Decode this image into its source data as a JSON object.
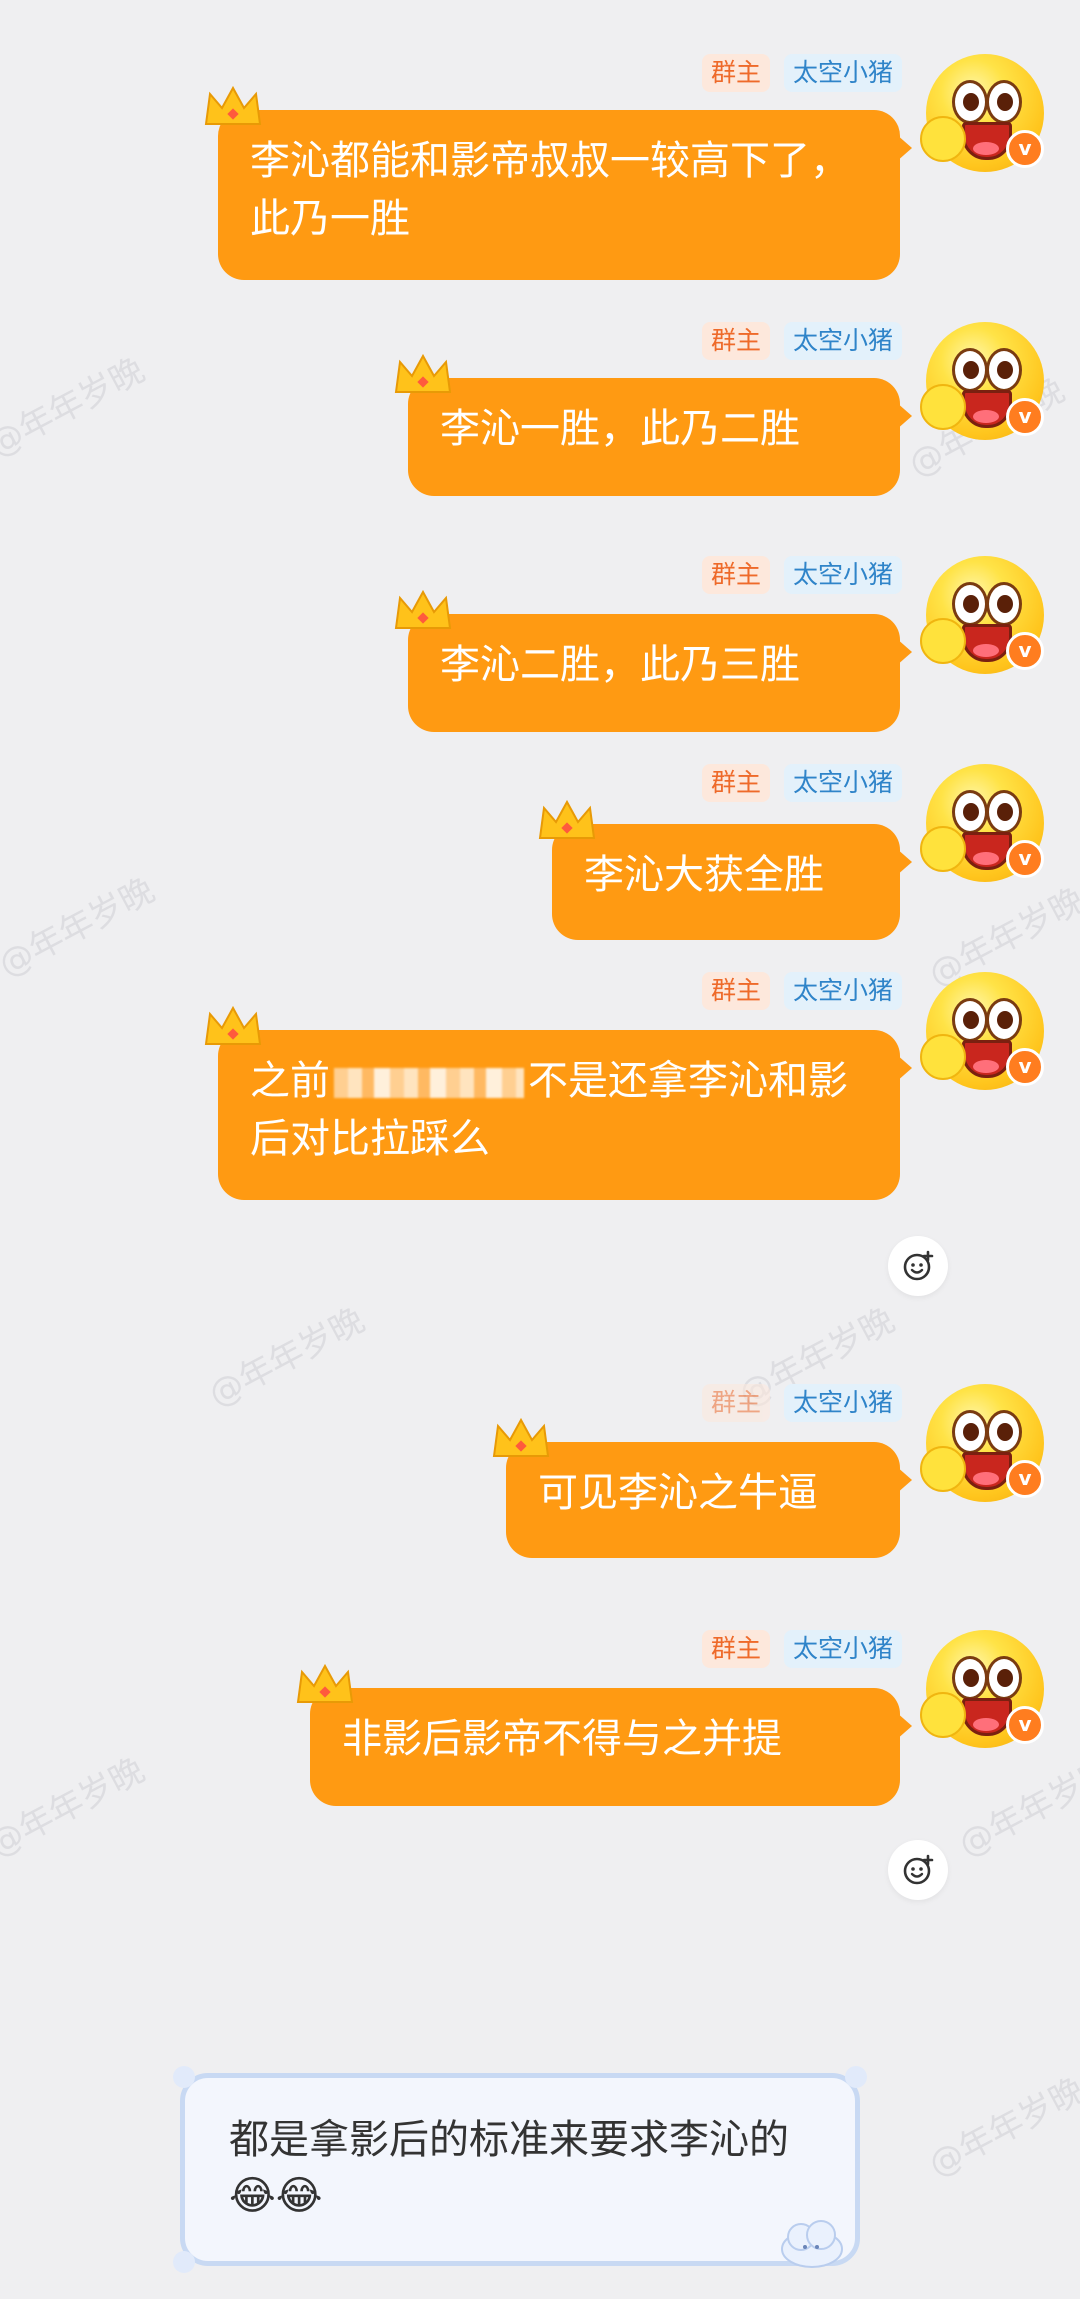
{
  "watermark": "@年年岁晚",
  "messages": [
    {
      "owner_tag": "群主",
      "name_tag": "太空小猪",
      "text": "李沁都能和影帝叔叔一较高下了，此乃一胜"
    },
    {
      "owner_tag": "群主",
      "name_tag": "太空小猪",
      "text": "李沁一胜，此乃二胜"
    },
    {
      "owner_tag": "群主",
      "name_tag": "太空小猪",
      "text": "李沁二胜，此乃三胜"
    },
    {
      "owner_tag": "群主",
      "name_tag": "太空小猪",
      "text": "李沁大获全胜"
    },
    {
      "owner_tag": "群主",
      "name_tag": "太空小猪",
      "text_before": "之前",
      "text_after": "不是还拿李沁和影后对比拉踩么"
    },
    {
      "owner_tag": "群主",
      "name_tag": "太空小猪",
      "text": "可见李沁之牛逼"
    },
    {
      "owner_tag": "群主",
      "name_tag": "太空小猪",
      "text": "非影后影帝不得与之并提"
    }
  ],
  "quote_message": {
    "text": "都是拿影后的标准来要求李沁的",
    "emoji": "😂😂"
  },
  "icons": {
    "avatar": "laughing-emoji-avatar",
    "badge": "v-badge-icon",
    "crown": "crown-icon",
    "reaction": "add-reaction-icon"
  },
  "colors": {
    "bubble": "#ff9a12",
    "background": "#efeff1",
    "owner_tag": "#ee6a2a",
    "name_tag": "#2f84c9",
    "quote_border": "#c8d9f3"
  }
}
